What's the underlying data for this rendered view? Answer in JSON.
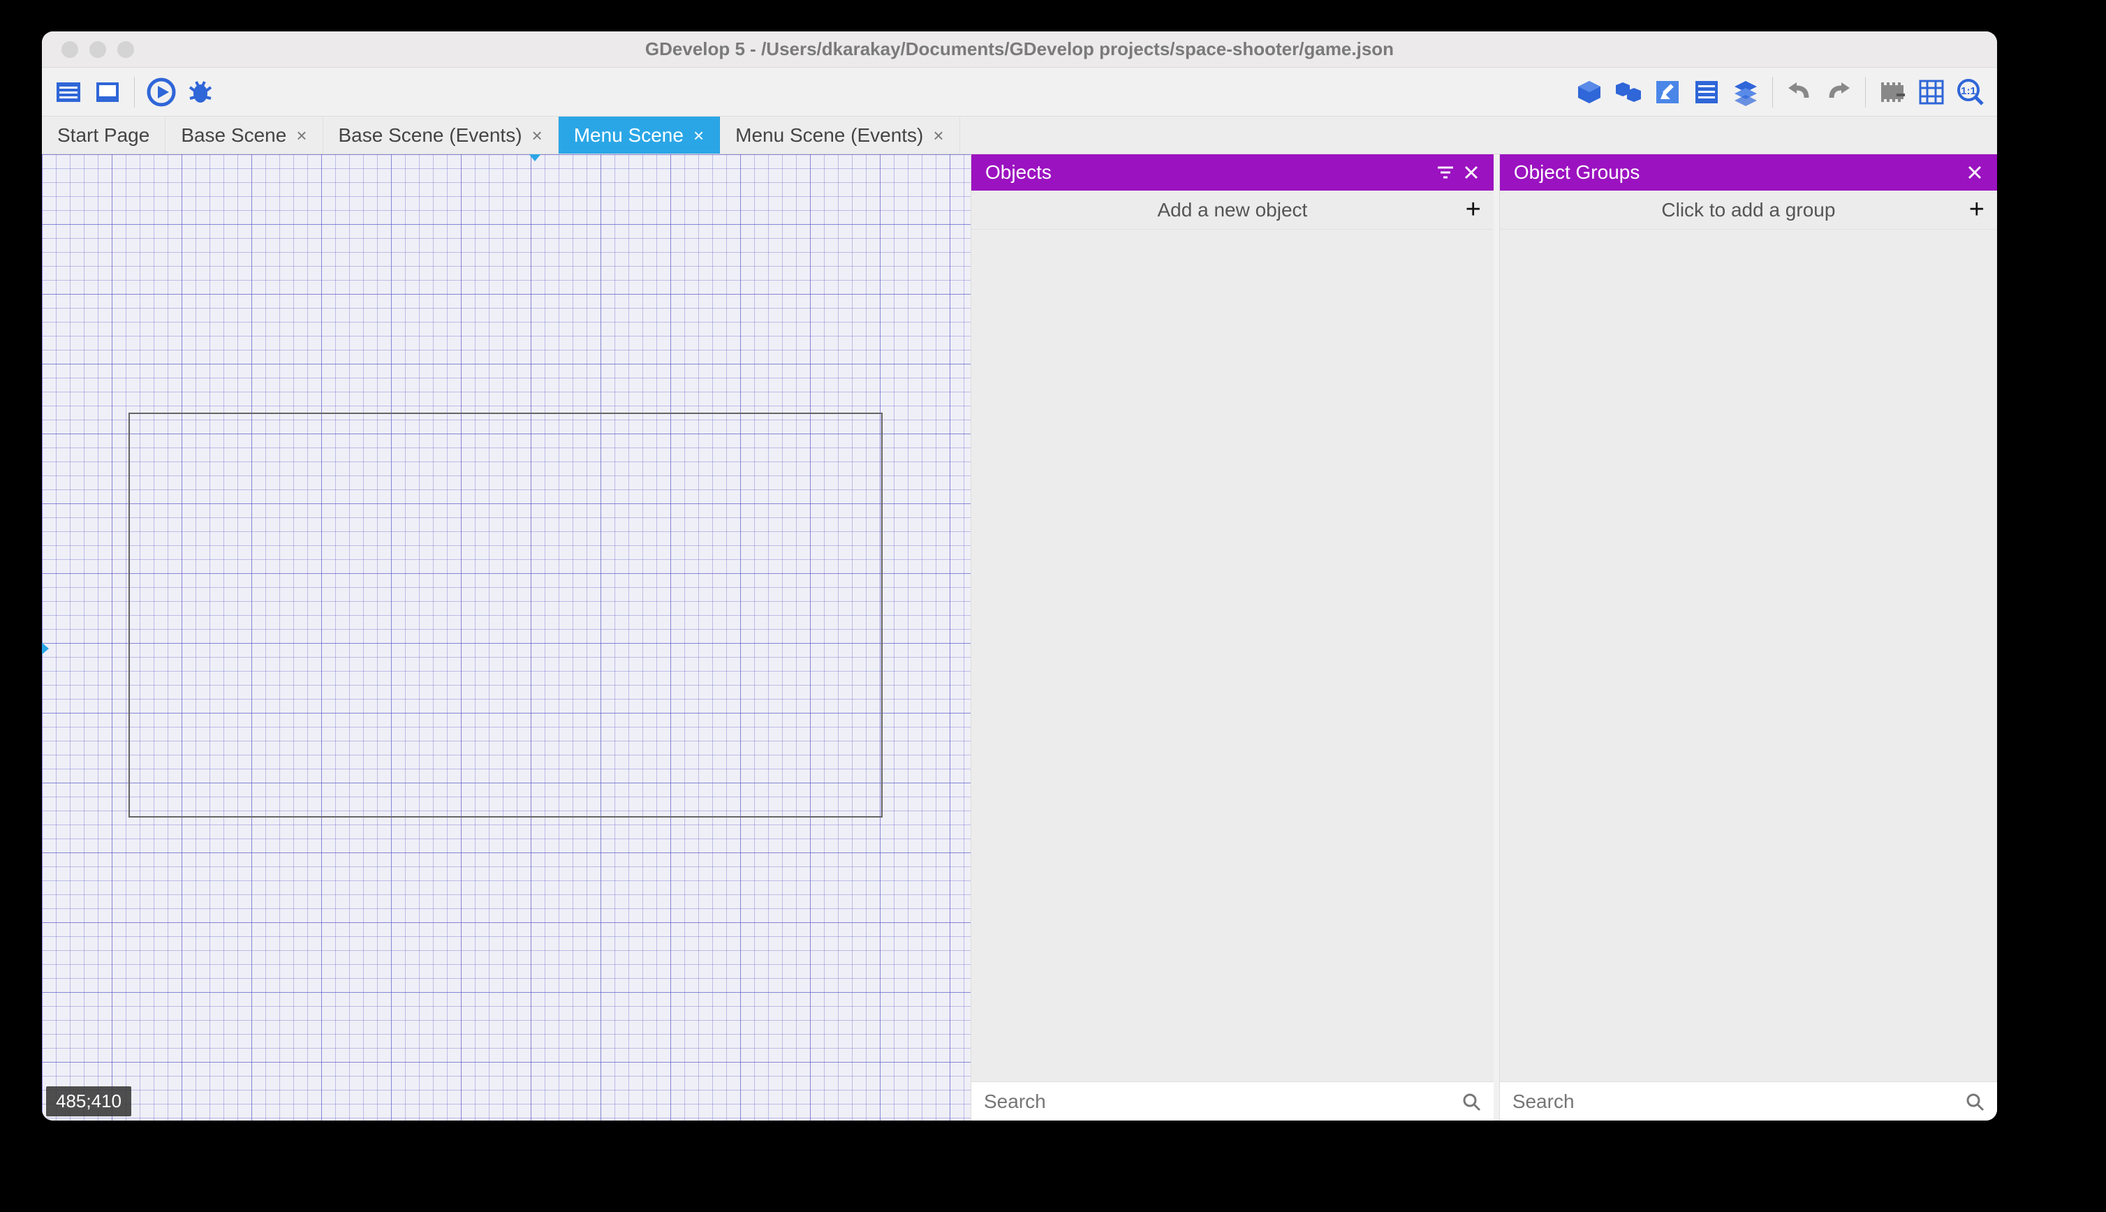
{
  "window": {
    "title": "GDevelop 5 - /Users/dkarakay/Documents/GDevelop projects/space-shooter/game.json"
  },
  "toolbar_left_icons": [
    "project-manager-icon",
    "export-icon",
    "play-icon",
    "debug-icon"
  ],
  "toolbar_right_icons": [
    "add-object-icon",
    "add-instance-icon",
    "edit-icon",
    "properties-icon",
    "layers-icon",
    "undo-icon",
    "redo-icon",
    "zoom-out-icon",
    "grid-icon",
    "zoom-fit-icon"
  ],
  "tabs": [
    {
      "label": "Start Page",
      "closeable": false,
      "active": false
    },
    {
      "label": "Base Scene",
      "closeable": true,
      "active": false
    },
    {
      "label": "Base Scene (Events)",
      "closeable": true,
      "active": false
    },
    {
      "label": "Menu Scene",
      "closeable": true,
      "active": true
    },
    {
      "label": "Menu Scene (Events)",
      "closeable": true,
      "active": false
    }
  ],
  "canvas": {
    "cursor_coord": "485;410"
  },
  "panels": {
    "objects": {
      "title": "Objects",
      "add_prompt": "Add a new object",
      "search_placeholder": "Search"
    },
    "groups": {
      "title": "Object Groups",
      "add_prompt": "Click to add a group",
      "search_placeholder": "Search"
    }
  },
  "colors": {
    "accent": "#2aa6e6",
    "panel_header": "#9b12c0"
  }
}
